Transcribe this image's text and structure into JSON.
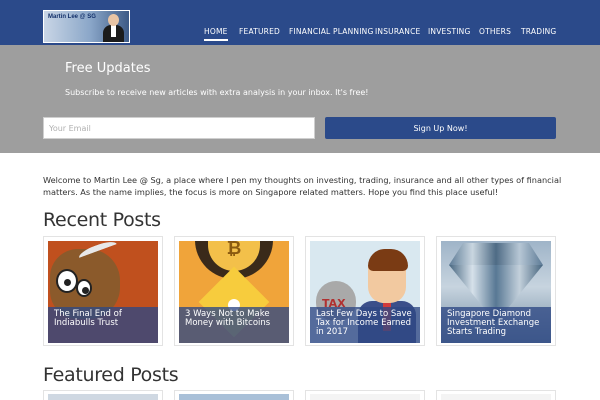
{
  "header": {
    "logo_text": "Martin Lee @ SG",
    "nav": [
      "HOME",
      "FEATURED",
      "FINANCIAL PLANNING",
      "INSURANCE",
      "INVESTING",
      "OTHERS",
      "TRADING"
    ],
    "active_nav": "HOME",
    "bg_color": "#2b4a8a"
  },
  "subscribe": {
    "title": "Free Updates",
    "subtitle": "Subscribe to receive new articles with extra analysis in your inbox. It's free!",
    "email_placeholder": "Your Email",
    "button_label": "Sign Up Now!",
    "band_color": "#9e9e9e"
  },
  "intro": "Welcome to Martin Lee @ Sg, a place where I pen my thoughts on investing, trading, insurance and all other types of financial matters. As the name implies, the focus is more on Singapore related matters. Hope you find this place useful!",
  "recent": {
    "heading": "Recent Posts",
    "posts": [
      {
        "title": "The Final End of Indiabulls Trust",
        "icon": "bull-icon"
      },
      {
        "title": "3 Ways Not to Make Money with Bitcoins",
        "icon": "bitcoin-icon"
      },
      {
        "title": "Last Few Days to Save Tax for Income Earned in 2017",
        "icon": "tax-man-icon"
      },
      {
        "title": "Singapore Diamond Investment Exchange Starts Trading",
        "icon": "diamond-icon"
      }
    ]
  },
  "featured": {
    "heading": "Featured Posts"
  }
}
